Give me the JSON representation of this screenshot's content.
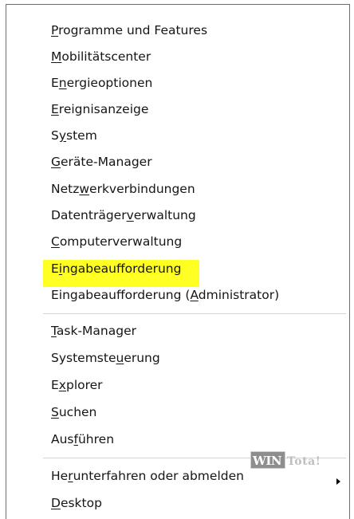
{
  "menu": {
    "group1": [
      {
        "pre": "",
        "key": "P",
        "post": "rogramme und Features"
      },
      {
        "pre": "",
        "key": "M",
        "post": "obilitätscenter"
      },
      {
        "pre": "E",
        "key": "n",
        "post": "ergieoptionen"
      },
      {
        "pre": "",
        "key": "E",
        "post": "reignisanzeige"
      },
      {
        "pre": "S",
        "key": "y",
        "post": "stem"
      },
      {
        "pre": "",
        "key": "G",
        "post": "eräte-Manager"
      },
      {
        "pre": "Netz",
        "key": "w",
        "post": "erkverbindungen"
      },
      {
        "pre": "Datenträger",
        "key": "v",
        "post": "erwaltung"
      },
      {
        "pre": "",
        "key": "C",
        "post": "omputerverwaltung"
      },
      {
        "pre": "E",
        "key": "i",
        "post": "ngabeaufforderung"
      },
      {
        "pre": "Eingabeaufforderung (",
        "key": "A",
        "post": "dministrator)"
      }
    ],
    "group2": [
      {
        "pre": "",
        "key": "T",
        "post": "ask-Manager"
      },
      {
        "pre": "Systemste",
        "key": "u",
        "post": "erung"
      },
      {
        "pre": "E",
        "key": "x",
        "post": "plorer"
      },
      {
        "pre": "",
        "key": "S",
        "post": "uchen"
      },
      {
        "pre": "Aus",
        "key": "f",
        "post": "ühren"
      }
    ],
    "group3": [
      {
        "pre": "He",
        "key": "r",
        "post": "unterfahren oder abmelden"
      },
      {
        "pre": "",
        "key": "D",
        "post": "esktop"
      }
    ]
  },
  "watermark": {
    "logo_text": "WIN",
    "suffix_text": "Tota!"
  },
  "colors": {
    "highlight": "#ffff24",
    "text": "#151515",
    "separator": "#d6d6d6",
    "frame": "#6d6d6d"
  },
  "icons": {
    "submenu_arrow": "chevron-right-icon"
  }
}
